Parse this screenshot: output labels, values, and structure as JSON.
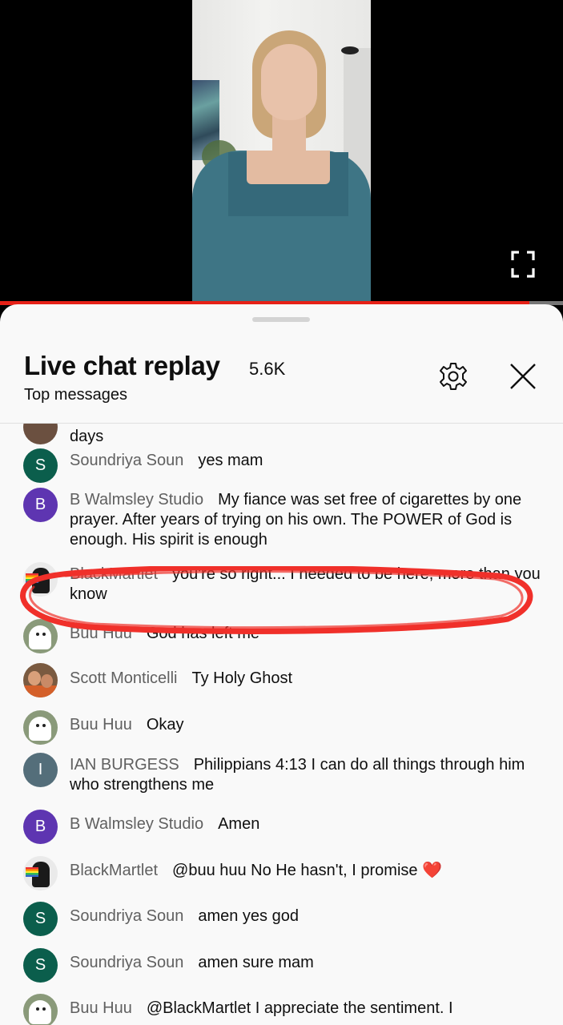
{
  "video": {
    "progress": 0.94,
    "accent": "#e62117"
  },
  "header": {
    "title": "Live chat replay",
    "count": "5.6K",
    "subtitle": "Top messages"
  },
  "messages": [
    {
      "author": "",
      "text": "days",
      "avatar": {
        "type": "image"
      }
    },
    {
      "author": "Soundriya Soun",
      "text": "yes mam",
      "avatar": {
        "type": "letter",
        "letter": "S",
        "color": "#0b5e4c"
      }
    },
    {
      "author": "B Walmsley Studio",
      "text": "My fiance was set free of cigarettes by one prayer. After years of trying on his own. The POWER of God is enough. His spirit is enough",
      "avatar": {
        "type": "letter",
        "letter": "B",
        "color": "#5e35b1"
      }
    },
    {
      "author": "BlackMartlet",
      "text": "you're so right... I needed to be here, more than you know",
      "avatar": {
        "type": "image"
      },
      "highlighted": true
    },
    {
      "author": "Buu Huu",
      "text": "God has left me",
      "avatar": {
        "type": "image"
      }
    },
    {
      "author": "Scott Monticelli",
      "text": "Ty Holy Ghost",
      "avatar": {
        "type": "image"
      }
    },
    {
      "author": "Buu Huu",
      "text": "Okay",
      "avatar": {
        "type": "image"
      }
    },
    {
      "author": "IAN BURGESS",
      "text": "Philippians 4:13 I can do all things through him who strengthens me",
      "avatar": {
        "type": "letter",
        "letter": "I",
        "color": "#546e7a"
      }
    },
    {
      "author": "B Walmsley Studio",
      "text": "Amen",
      "avatar": {
        "type": "letter",
        "letter": "B",
        "color": "#5e35b1"
      }
    },
    {
      "author": "BlackMartlet",
      "text": "@buu huu No He hasn't, I promise ❤️",
      "avatar": {
        "type": "image"
      }
    },
    {
      "author": "Soundriya Soun",
      "text": "amen yes god",
      "avatar": {
        "type": "letter",
        "letter": "S",
        "color": "#0b5e4c"
      }
    },
    {
      "author": "Soundriya Soun",
      "text": "amen sure mam",
      "avatar": {
        "type": "letter",
        "letter": "S",
        "color": "#0b5e4c"
      }
    },
    {
      "author": "Buu Huu",
      "text": "@BlackMartlet I appreciate the sentiment. I",
      "avatar": {
        "type": "image"
      }
    }
  ],
  "icons": {
    "fullscreen": "fullscreen-icon",
    "settings": "gear-icon",
    "close": "close-icon"
  },
  "annotation": {
    "color": "#f0302a"
  }
}
